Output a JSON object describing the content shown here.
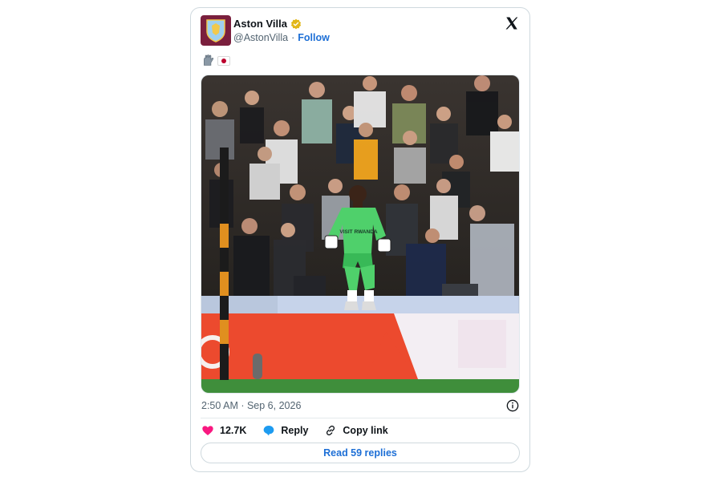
{
  "tweet": {
    "author_name": "Aston Villa",
    "handle": "@AstonVilla",
    "separator": "·",
    "follow_label": "Follow",
    "timestamp": "2:50 AM · Sep 6, 2026",
    "icons": {
      "avatar": "aston-villa-crest-avatar",
      "verified": "verified-badge-icon",
      "brand": "x-logo-icon",
      "emoji_1": "gloves-emoji",
      "emoji_2": "japan-flag-emoji",
      "info": "info-icon"
    },
    "media": {
      "image_text": "VISIT RWANDA"
    },
    "actions": {
      "likes_count": "12.7K",
      "reply_label": "Reply",
      "copy_label": "Copy link"
    },
    "read_replies_label": "Read 59 replies"
  },
  "colors": {
    "accent_blue": "#1d6fd6",
    "like_pink": "#f91880",
    "verified_gold": "#e2b719",
    "club_claret": "#7a1f3d",
    "keeper_kit_green": "#4fd06b"
  }
}
